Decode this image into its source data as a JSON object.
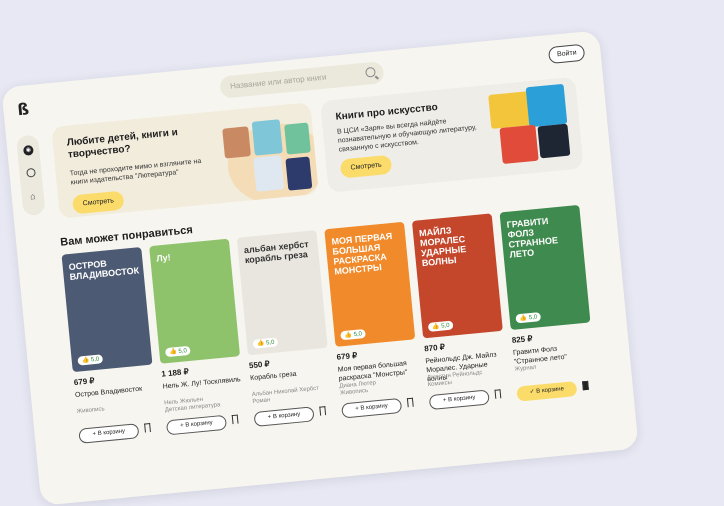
{
  "header": {
    "search_placeholder": "Название или автор книги",
    "login_label": "Войти"
  },
  "sidebar": {
    "icons": [
      "compass-icon",
      "ball-icon",
      "basket-icon"
    ]
  },
  "banners": [
    {
      "title": "Любите детей, книги и творчество?",
      "text": "Тогда не проходите мимо и взгляните на книги издательства \"Лютература\"",
      "button": "Смотреть"
    },
    {
      "title": "Книги про искусство",
      "text": "В ЦСИ «Заря» вы всегда найдёте познавательную и обучающую литературу, связанную с искусством.",
      "button": "Смотреть"
    }
  ],
  "section": {
    "title": "Вам может понравиться"
  },
  "books": [
    {
      "cover_text": "ОСТРОВ ВЛАДИВОСТОК",
      "rating": "5,0",
      "price": "679 ₽",
      "title": "Остров Владивосток",
      "meta": "Живопись",
      "button": "+ В корзину",
      "in_cart": false,
      "color": "#4d5a73"
    },
    {
      "cover_text": "Лу!",
      "rating": "5,0",
      "price": "1 188 ₽",
      "title": "Нель Ж. Лу! Тосклявиль",
      "meta": "Нель Жюльен\nДетская литература",
      "button": "+ В корзину",
      "in_cart": false,
      "color": "#8fc36b"
    },
    {
      "cover_text": "альбан хербст  корабль греза",
      "rating": "5,0",
      "price": "550 ₽",
      "title": "Корабль греза",
      "meta": "Альбан Николай Хербст\nРоман",
      "button": "+ В корзину",
      "in_cart": false,
      "color": "#e9e6df"
    },
    {
      "cover_text": "МОЯ ПЕРВАЯ БОЛЬШАЯ РАСКРАСКА МОНСТРЫ",
      "rating": "5,0",
      "price": "679 ₽",
      "title": "Моя первая большая раскраска \"Монстры\"",
      "meta": "Диана Лютер\nЖивопись",
      "button": "+ В корзину",
      "in_cart": false,
      "color": "#f08a2a"
    },
    {
      "cover_text": "МАЙЛЗ МОРАЛЕС УДАРНЫЕ ВОЛНЫ",
      "rating": "5,0",
      "price": "870 ₽",
      "title": "Рейнольдс Дж. Майлз Моралес. Ударные волны",
      "meta": "Джастин Рейнольдс\nКомиксы",
      "button": "+ В корзину",
      "in_cart": false,
      "color": "#c4472c"
    },
    {
      "cover_text": "ГРАВИТИ ФОЛЗ  СТРАННОЕ ЛЕТО",
      "rating": "5,0",
      "price": "825 ₽",
      "title": "Гравити Фолз \"Странное лето\"",
      "meta": "Журнал",
      "button": "✓ В корзине",
      "in_cart": true,
      "color": "#3f8a4e"
    }
  ]
}
